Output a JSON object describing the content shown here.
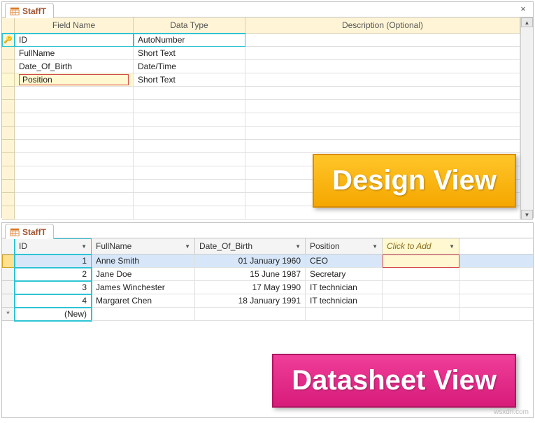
{
  "design": {
    "tab_name": "StaffT",
    "headers": {
      "field": "Field Name",
      "datatype": "Data Type",
      "desc": "Description (Optional)"
    },
    "rows": [
      {
        "field": "ID",
        "datatype": "AutoNumber",
        "pk": true,
        "hl": true
      },
      {
        "field": "FullName",
        "datatype": "Short Text"
      },
      {
        "field": "Date_Of_Birth",
        "datatype": "Date/Time"
      },
      {
        "field": "Position",
        "datatype": "Short Text",
        "editing": true
      }
    ],
    "blank_rows": 10,
    "badge": "Design View"
  },
  "datasheet": {
    "tab_name": "StaffT",
    "columns": [
      "ID",
      "FullName",
      "Date_Of_Birth",
      "Position"
    ],
    "click_to_add": "Click to Add",
    "rows": [
      {
        "id": "1",
        "name": "Anne Smith",
        "dob": "01 January 1960",
        "pos": "CEO",
        "sel": true
      },
      {
        "id": "2",
        "name": "Jane Doe",
        "dob": "15 June 1987",
        "pos": "Secretary"
      },
      {
        "id": "3",
        "name": "James Winchester",
        "dob": "17 May 1990",
        "pos": "IT technician"
      },
      {
        "id": "4",
        "name": "Margaret Chen",
        "dob": "18 January 1991",
        "pos": "IT technician"
      }
    ],
    "new_row_label": "(New)",
    "badge": "Datasheet View"
  },
  "watermark": "wsxdn.com"
}
